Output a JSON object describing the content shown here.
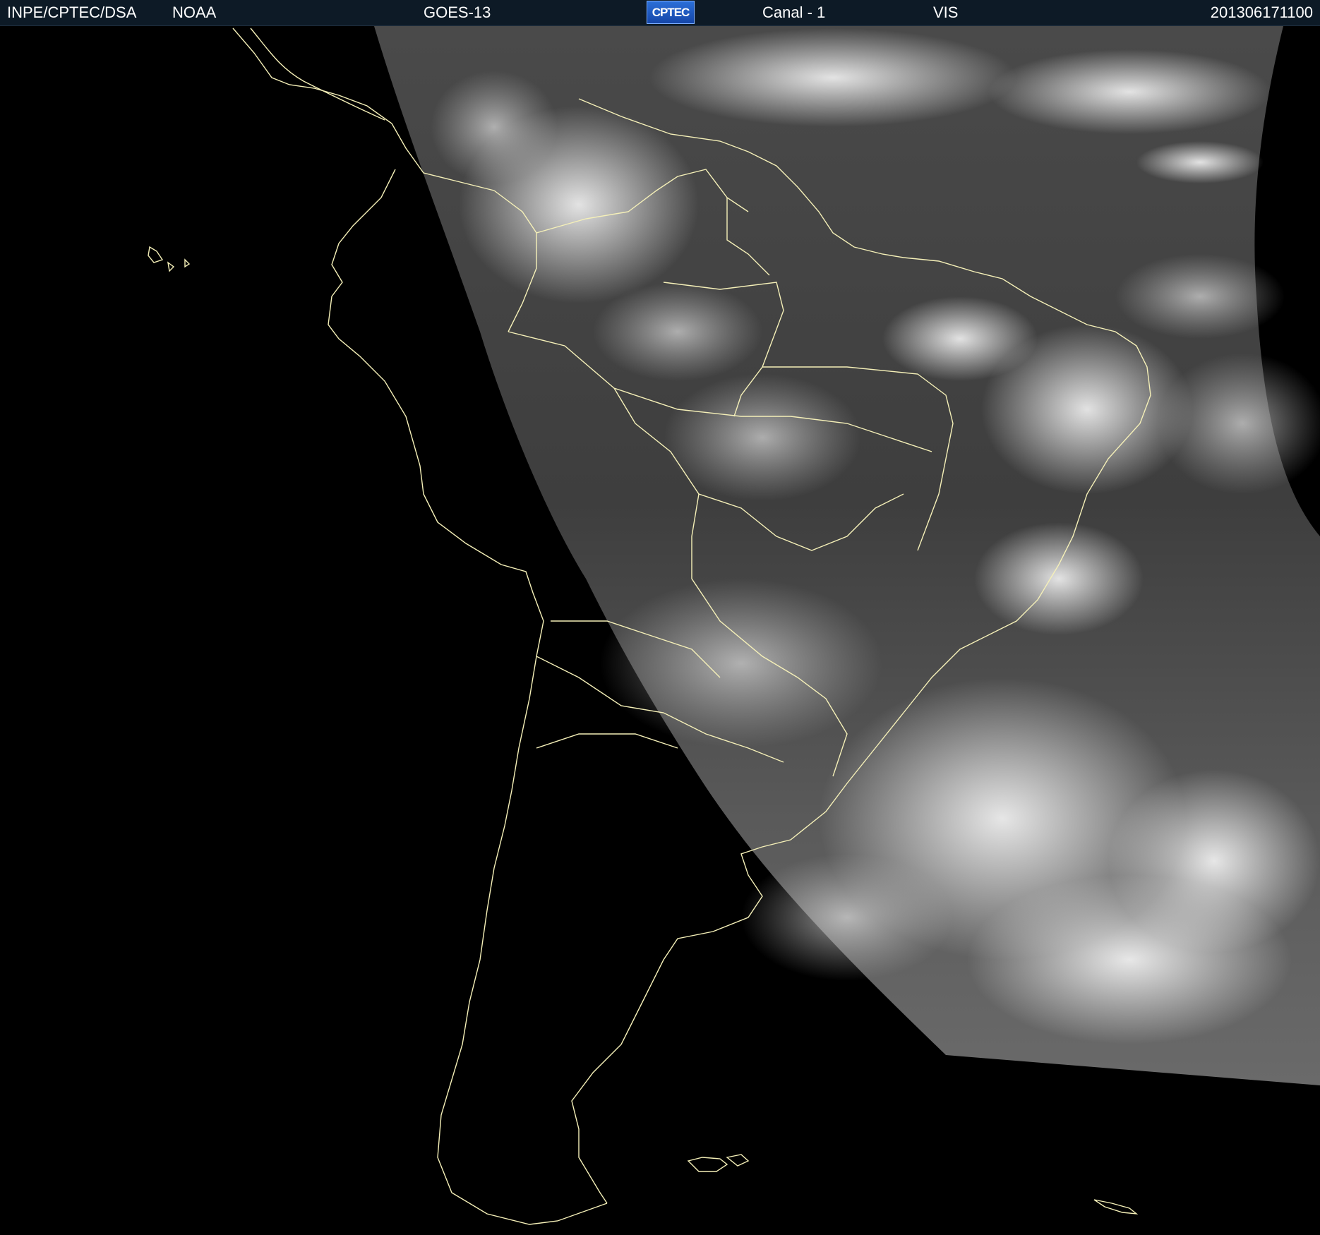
{
  "header": {
    "org": "INPE/CPTEC/DSA",
    "agency": "NOAA",
    "satellite": "GOES-13",
    "logo_text": "CPTEC",
    "channel": "Canal - 1",
    "band": "VIS",
    "timestamp": "201306171100"
  },
  "colors": {
    "header_bg": "#0d1a26",
    "header_text": "#ffffff",
    "coastline": "#f5f0b8",
    "space": "#000000"
  }
}
